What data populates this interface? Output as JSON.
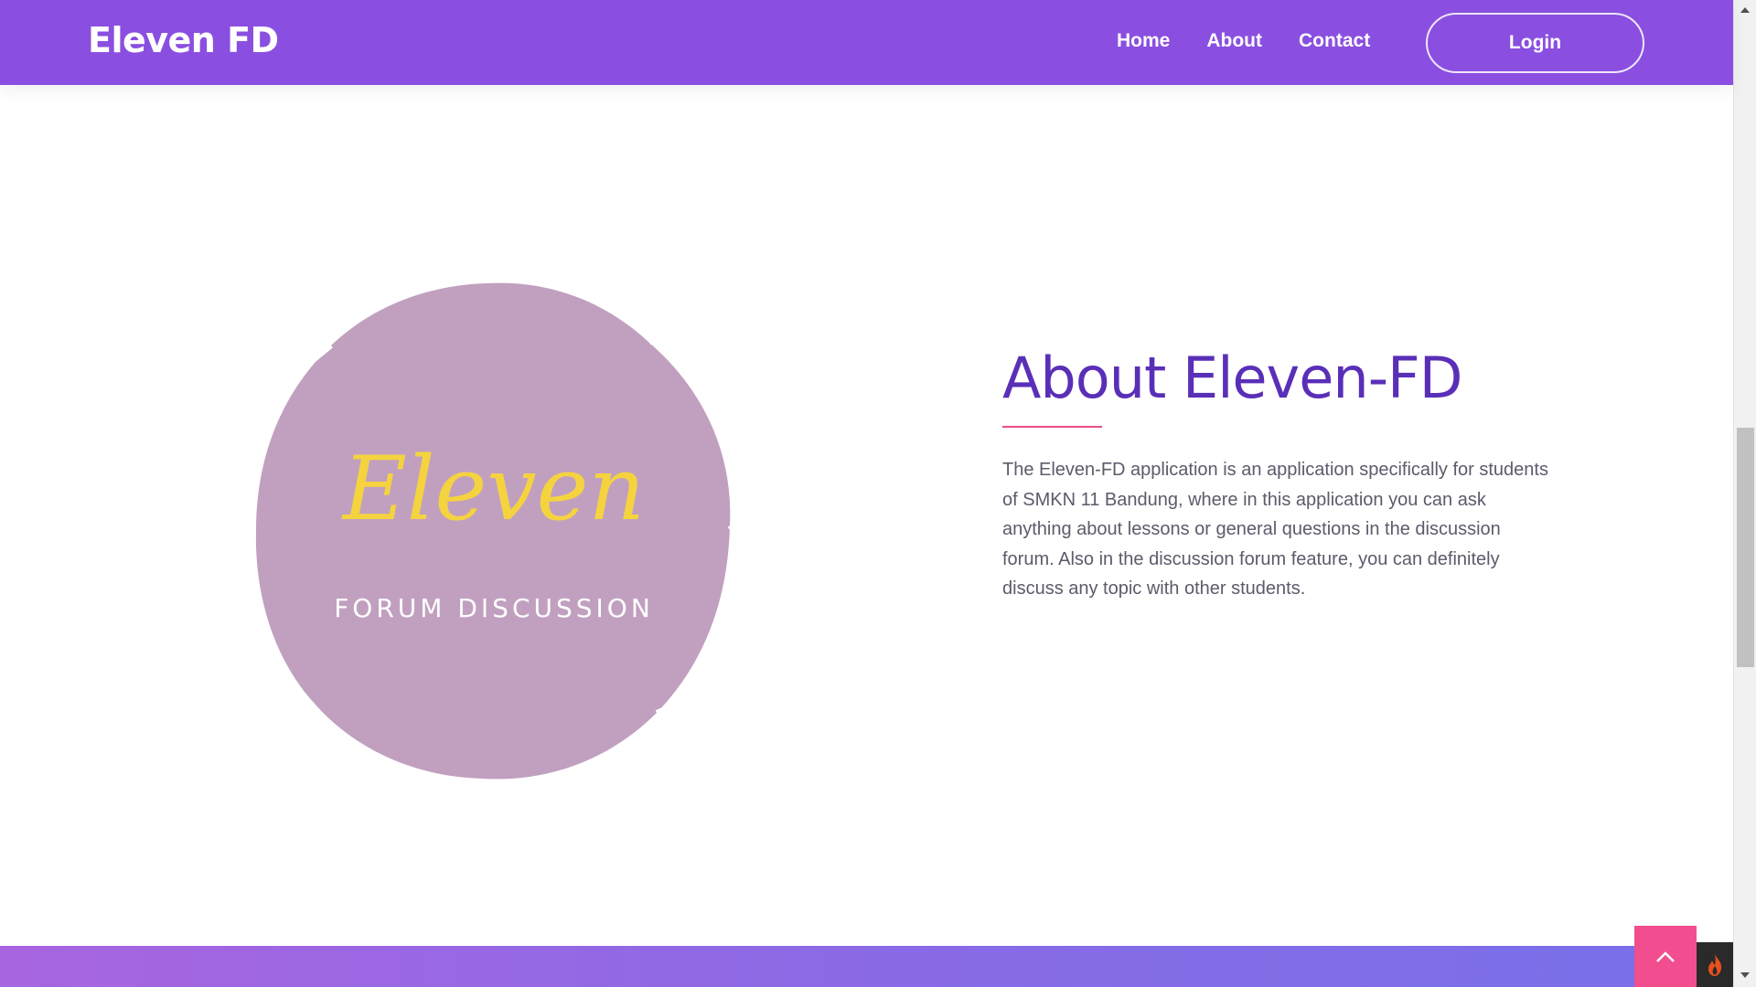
{
  "navbar": {
    "brand": "Eleven FD",
    "links": [
      {
        "label": "Home"
      },
      {
        "label": "About"
      },
      {
        "label": "Contact"
      }
    ],
    "login_label": "Login"
  },
  "logo": {
    "script_text": "Eleven",
    "subtitle": "FORUM DISCUSSION"
  },
  "about": {
    "title": "About Eleven-FD",
    "description": "The Eleven-FD application is an application specifically for students of SMKN 11 Bandung, where in this application you can ask anything about lessons or general questions in the discussion forum. Also in the discussion forum feature, you can definitely discuss any topic with other students."
  },
  "colors": {
    "navbar": "#8a4fe0",
    "title": "#5a2fb8",
    "accent": "#ec4c8a",
    "logo_circle": "#c1a0bf",
    "logo_script": "#f5d33f",
    "back_to_top": "#f24d8e"
  },
  "icons": {
    "back_to_top": "chevron-up-icon",
    "dev_toolbar": "flame-icon"
  }
}
